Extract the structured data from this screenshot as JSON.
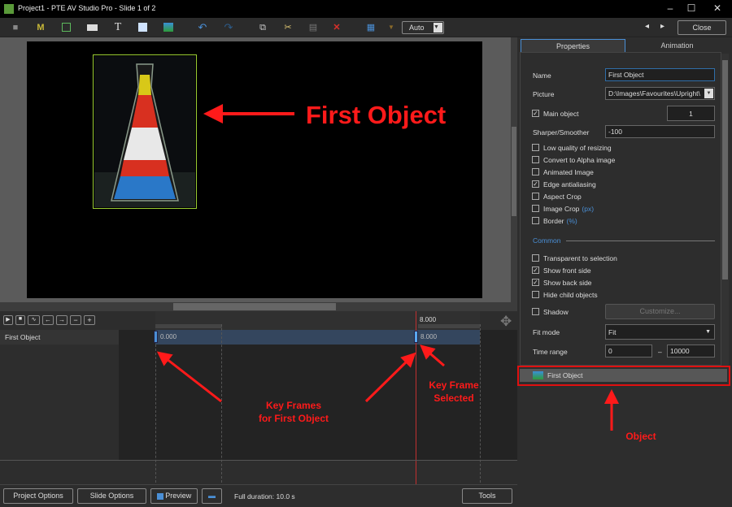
{
  "window": {
    "title": "Project1 - PTE AV Studio Pro - Slide 1 of 2",
    "minimize": "–",
    "maximize": "☐",
    "close": "✕"
  },
  "toolbar": {
    "zoom_value": "Auto",
    "close_label": "Close",
    "prev": "◂",
    "next": "▸"
  },
  "panel": {
    "tabs": [
      "Properties",
      "Animation"
    ],
    "name_label": "Name",
    "name_value": "First Object",
    "picture_label": "Picture",
    "picture_value": "D:\\Images\\Favourites\\Upright\\",
    "main_object_label": "Main object",
    "main_object_value": "1",
    "sharper_label": "Sharper/Smoother",
    "sharper_value": "-100",
    "checkboxes": [
      {
        "label": "Low quality of resizing",
        "checked": false
      },
      {
        "label": "Convert to Alpha image",
        "checked": false
      },
      {
        "label": "Animated Image",
        "checked": false
      },
      {
        "label": "Edge antialiasing",
        "checked": true
      },
      {
        "label": "Aspect Crop",
        "checked": false
      },
      {
        "label": "Image Crop",
        "suffix": "(px)",
        "checked": false
      },
      {
        "label": "Border",
        "suffix": "(%)",
        "checked": false
      }
    ],
    "common_label": "Common",
    "common_checkboxes": [
      {
        "label": "Transparent to selection",
        "checked": false
      },
      {
        "label": "Show front side",
        "checked": true
      },
      {
        "label": "Show back side",
        "checked": true
      },
      {
        "label": "Hide child objects",
        "checked": false
      }
    ],
    "shadow_label": "Shadow",
    "customize_label": "Customize...",
    "fit_mode_label": "Fit mode",
    "fit_mode_value": "Fit",
    "time_range_label": "Time range",
    "time_from": "0",
    "time_sep": "–",
    "time_to": "10000",
    "object_list": [
      {
        "name": "First Object"
      }
    ]
  },
  "timeline": {
    "ruler_time": "8.000",
    "track_name": "First Object",
    "keyframes": [
      "0.000",
      "8.000"
    ]
  },
  "bottom": {
    "project_options": "Project Options",
    "slide_options": "Slide Options",
    "preview": "Preview",
    "duration": "Full duration: 10.0 s",
    "tools": "Tools"
  },
  "annotations": {
    "first_object": "First Object",
    "key_frames_1": "Key Frames",
    "key_frames_2": "for First Object",
    "key_frame_sel_1": "Key Frame",
    "key_frame_sel_2": "Selected",
    "object": "Object"
  },
  "colors": {
    "annotation": "#ff1a1a",
    "selection": "#9acd32",
    "accent": "#4a8fd6"
  }
}
